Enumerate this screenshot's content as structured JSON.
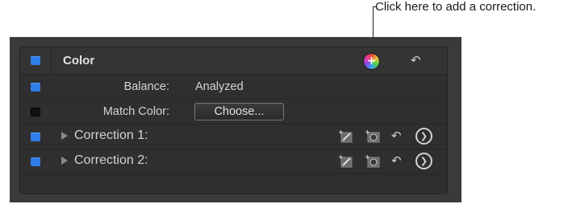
{
  "callout": {
    "text": "Click here to add a correction."
  },
  "panel": {
    "header": {
      "title": "Color",
      "enabled": true
    },
    "balance": {
      "label": "Balance:",
      "value": "Analyzed",
      "enabled": true
    },
    "match_color": {
      "label": "Match Color:",
      "button_label": "Choose...",
      "enabled": false
    },
    "corrections": [
      {
        "label": "Correction 1:",
        "enabled": true
      },
      {
        "label": "Correction 2:",
        "enabled": true
      }
    ]
  },
  "icons": {
    "add": "add-correction-icon",
    "undo": "reset-icon",
    "wand": "magic-wand-icon",
    "mask": "shape-mask-icon",
    "nav": "chevron-right-icon",
    "disclosure": "disclosure-triangle-icon"
  },
  "colors": {
    "accent_blue": "#2f7de8",
    "panel_bg": "#2f2f30",
    "outer_bg": "#3a3a3b"
  }
}
